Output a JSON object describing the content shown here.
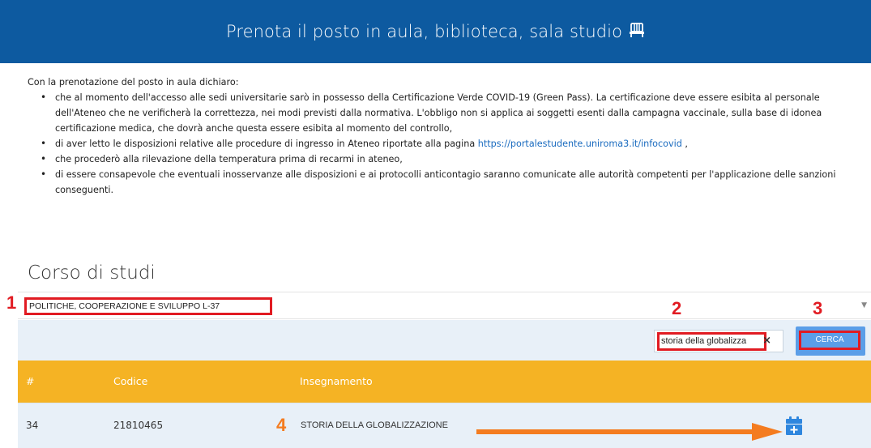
{
  "header": {
    "title": "Prenota il posto in aula, biblioteca, sala studio",
    "icon": "chair-icon"
  },
  "intro": {
    "lead": "Con la prenotazione del posto in aula dichiaro:",
    "bullets": [
      "che al momento dell'accesso alle sedi universitarie sarò in possesso della Certificazione Verde COVID-19 (Green Pass). La certificazione deve essere esibita al personale dell'Ateneo che ne verificherà la correttezza, nei modi previsti dalla normativa. L'obbligo non si applica ai soggetti esenti dalla campagna vaccinale, sulla base di idonea certificazione medica, che dovrà anche questa essere esibita al momento del controllo,",
      "di aver letto le disposizioni relative alle procedure di ingresso in Ateneo riportate alla pagina",
      "che procederò alla rilevazione della temperatura prima di recarmi in ateneo,",
      "di essere consapevole che eventuali inosservanze alle disposizioni e ai protocolli anticontagio saranno comunicate alle autorità competenti per l'applicazione delle sanzioni conseguenti."
    ],
    "link_text": "https://portalestudente.uniroma3.it/infocovid",
    "link_suffix": " ,"
  },
  "course": {
    "section_title": "Corso di studi",
    "selected": "POLITICHE, COOPERAZIONE E SVILUPPO L-37"
  },
  "search": {
    "value": "storia della globalizza",
    "clear_symbol": "×",
    "button_label": "CERCA"
  },
  "markers": {
    "m1": "1",
    "m2": "2",
    "m3": "3",
    "m4": "4"
  },
  "table": {
    "headers": {
      "num": "#",
      "code": "Codice",
      "name": "Insegnamento"
    },
    "rows": [
      {
        "num": "34",
        "code": "21810465",
        "name": "STORIA DELLA GLOBALIZZAZIONE"
      }
    ]
  },
  "colors": {
    "header_bg": "#0d5aa0",
    "table_header_bg": "#f5b324",
    "row_bg": "#e8f0f8",
    "highlight_red": "#e11b22",
    "arrow_orange": "#f47c20",
    "button_blue": "#5b9ee8"
  }
}
